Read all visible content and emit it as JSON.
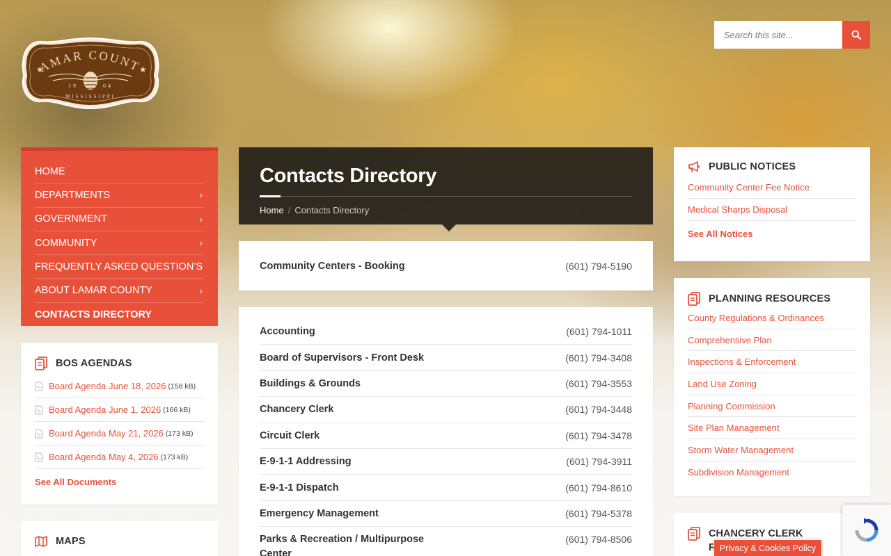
{
  "colors": {
    "accent": "#e8503a",
    "dark_header": "#231e19",
    "logo_brown": "#6b3a10"
  },
  "search": {
    "placeholder": "Search this site...",
    "icon": "search-icon"
  },
  "logo": {
    "line1": "LAMAR COUNTY",
    "year_left": "19",
    "year_right": "04",
    "state": "MISSISSIPPI"
  },
  "nav": {
    "items": [
      {
        "label": "HOME",
        "has_submenu": false
      },
      {
        "label": "DEPARTMENTS",
        "has_submenu": true
      },
      {
        "label": "GOVERNMENT",
        "has_submenu": true
      },
      {
        "label": "COMMUNITY",
        "has_submenu": true
      },
      {
        "label": "FREQUENTLY ASKED QUESTION’S",
        "has_submenu": false
      },
      {
        "label": "ABOUT LAMAR COUNTY",
        "has_submenu": true
      },
      {
        "label": "CONTACTS DIRECTORY",
        "has_submenu": false,
        "active": true
      }
    ]
  },
  "bos_agendas": {
    "title": "BOS AGENDAS",
    "icon": "documents-icon",
    "docs": [
      {
        "name": "Board Agenda June 18, 2026",
        "size": "(158 kB)"
      },
      {
        "name": "Board Agenda June 1, 2026",
        "size": "(166 kB)"
      },
      {
        "name": "Board Agenda May 21, 2026",
        "size": "(173 kB)"
      },
      {
        "name": "Board Agenda May 4, 2026",
        "size": "(173 kB)"
      }
    ],
    "see_all": "See All Documents"
  },
  "maps": {
    "title": "MAPS",
    "icon": "map-icon"
  },
  "page": {
    "title": "Contacts Directory",
    "breadcrumb_home": "Home",
    "breadcrumb_sep": "/",
    "breadcrumb_current": "Contacts Directory"
  },
  "featured_contact": {
    "name": "Community Centers - Booking",
    "phone": "(601) 794-5190"
  },
  "contacts": [
    {
      "name": "Accounting",
      "phone": "(601) 794-1011"
    },
    {
      "name": "Board of Supervisors - Front Desk",
      "phone": "(601) 794-3408"
    },
    {
      "name": "Buildings & Grounds",
      "phone": "(601) 794-3553"
    },
    {
      "name": "Chancery Clerk",
      "phone": "(601) 794-3448"
    },
    {
      "name": "Circuit Clerk",
      "phone": "(601) 794-3478"
    },
    {
      "name": "E-9-1-1 Addressing",
      "phone": "(601) 794-3911"
    },
    {
      "name": "E-9-1-1 Dispatch",
      "phone": "(601) 794-8610"
    },
    {
      "name": "Emergency Management",
      "phone": "(601) 794-5378"
    },
    {
      "name": "Parks & Recreation / Multipurpose Center",
      "phone": "(601) 794-8506"
    }
  ],
  "public_notices": {
    "title": "PUBLIC NOTICES",
    "icon": "megaphone-icon",
    "links": [
      "Community Center Fee Notice",
      "Medical Sharps Disposal"
    ],
    "see_all": "See All Notices"
  },
  "planning_resources": {
    "title": "PLANNING RESOURCES",
    "icon": "documents-icon",
    "links": [
      "County Regulations & Ordinances",
      "Comprehensive Plan",
      "Inspections & Enforcement",
      "Land Use Zoning",
      "Planning Commission",
      "Site Plan Management",
      "Storm Water Management",
      "Subdivision Management"
    ]
  },
  "chancery_clerk": {
    "title_line1": "CHANCERY CLERK",
    "title_line2": "R",
    "icon": "documents-icon"
  },
  "cookie": {
    "label": "Privacy & Cookies Policy"
  },
  "recaptcha": {
    "icon": "recaptcha-icon"
  }
}
